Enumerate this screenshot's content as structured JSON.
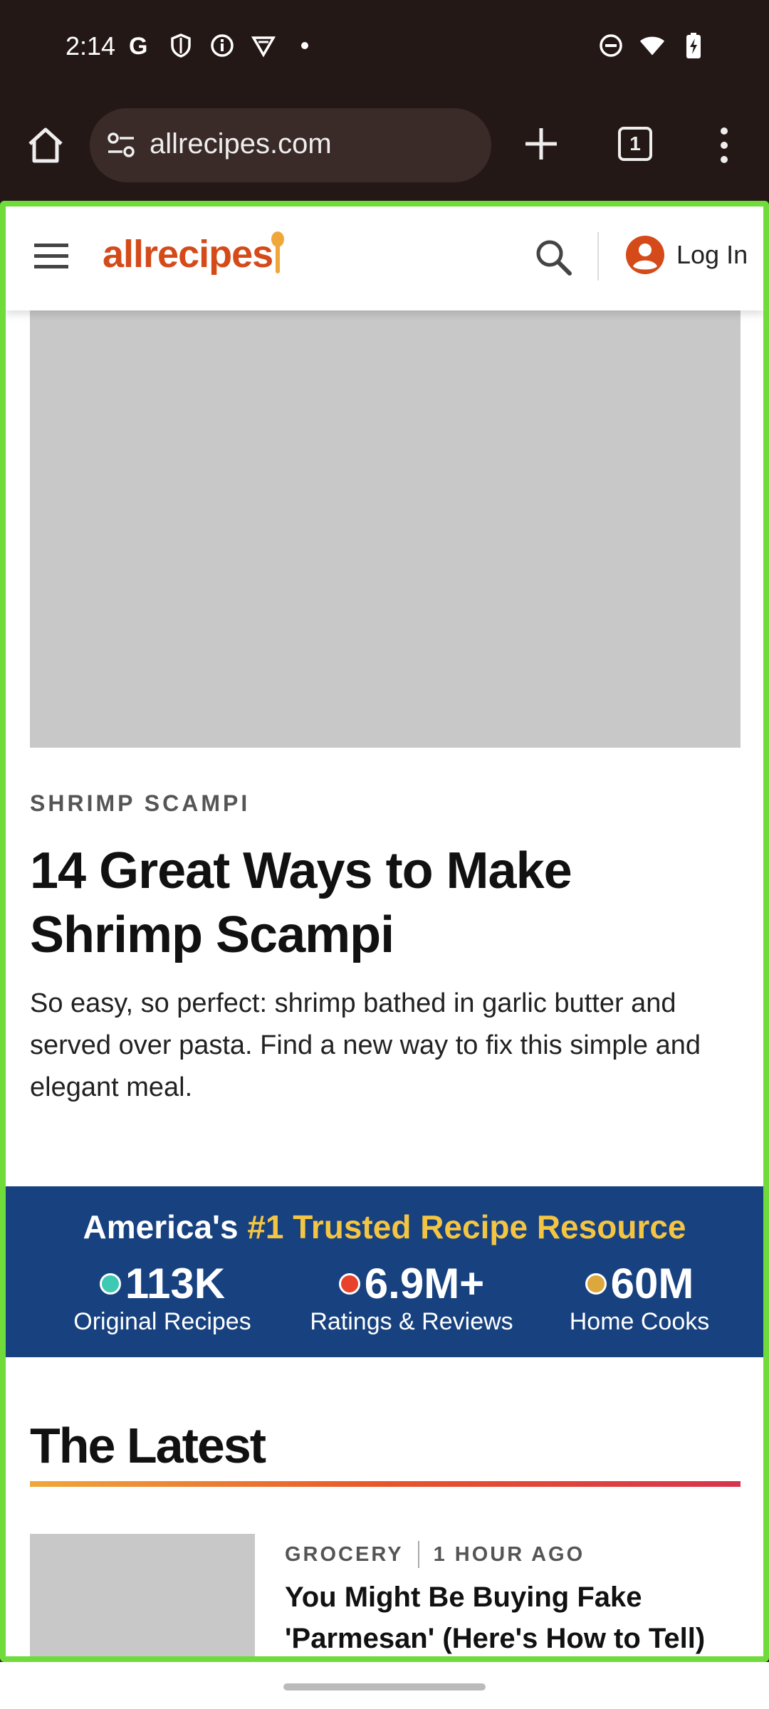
{
  "status_bar": {
    "time": "2:14",
    "left_icons": [
      "google-icon",
      "shield-icon",
      "info-icon",
      "vpn-icon",
      "dot-icon"
    ],
    "right_icons": [
      "dnd-icon",
      "wifi-icon",
      "battery-charging-icon"
    ]
  },
  "browser": {
    "url": "allrecipes.com",
    "tab_count": "1"
  },
  "site": {
    "logo_text": "allrecipes",
    "login_label": "Log In",
    "colors": {
      "brand": "#d54a19",
      "banner": "#17417f",
      "highlight": "#f4c542"
    }
  },
  "article": {
    "kicker": "SHRIMP SCAMPI",
    "headline": "14 Great Ways to Make Shrimp Scampi",
    "dek": "So easy, so perfect: shrimp bathed in garlic butter and served over pasta. Find a new way to fix this simple and elegant meal."
  },
  "banner": {
    "title_prefix": "America's ",
    "title_highlight": "#1 Trusted Recipe Resource",
    "stats": [
      {
        "value": "113K",
        "label": "Original Recipes",
        "dot_color": "#3ec9b5"
      },
      {
        "value": "6.9M+",
        "label": "Ratings & Reviews",
        "dot_color": "#e8412c"
      },
      {
        "value": "60M",
        "label": "Home Cooks",
        "dot_color": "#dca73c"
      }
    ]
  },
  "latest": {
    "title": "The Latest",
    "items": [
      {
        "category": "GROCERY",
        "time": "1 HOUR AGO",
        "title": "You Might Be Buying Fake 'Parmesan' (Here's How to Tell)"
      }
    ]
  }
}
